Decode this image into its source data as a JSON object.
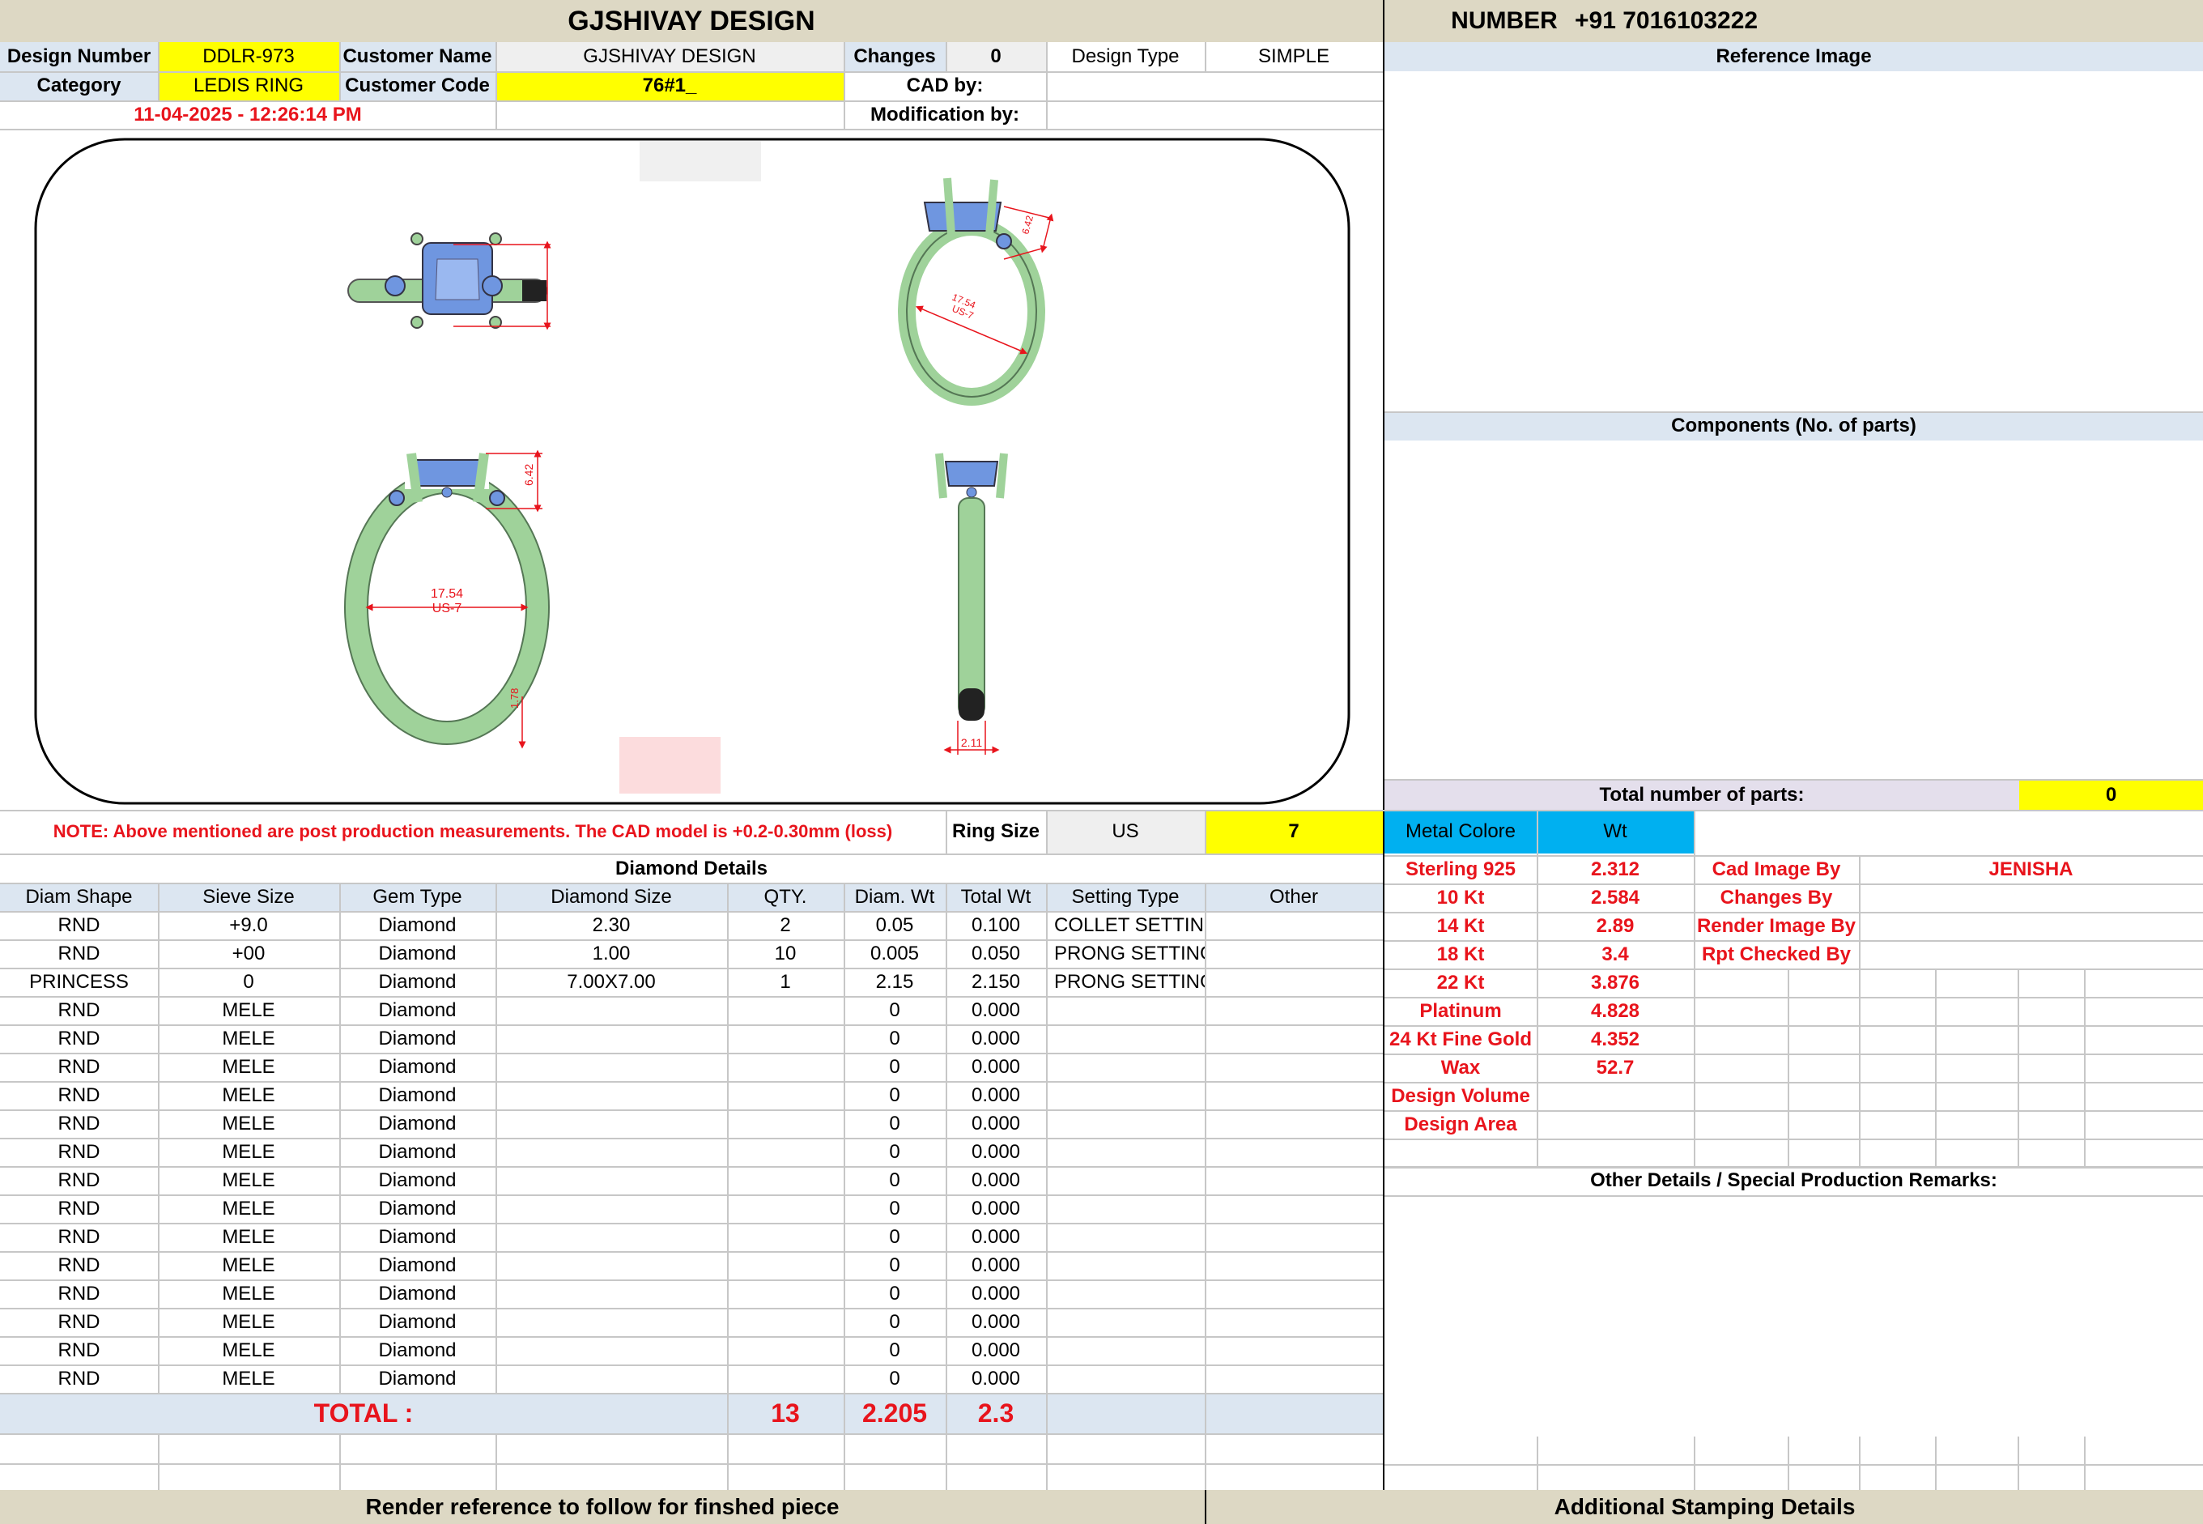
{
  "header": {
    "company": "GJSHIVAY DESIGN",
    "number_label": "NUMBER",
    "phone": "+91 7016103222"
  },
  "info": {
    "design_number_label": "Design Number",
    "design_number": "DDLR-973",
    "customer_name_label": "Customer Name",
    "customer_name": "GJSHIVAY DESIGN",
    "changes_label": "Changes",
    "changes": "0",
    "design_type_label": "Design Type",
    "design_type": "SIMPLE",
    "category_label": "Category",
    "category": "LEDIS RING",
    "customer_code_label": "Customer Code",
    "customer_code": "76#1_",
    "cad_by_label": "CAD by:",
    "modification_by_label": "Modification by:",
    "datetime": "11-04-2025 - 12:26:14 PM"
  },
  "drawings": {
    "top_width": "17.54",
    "top_size": "US-7",
    "top_height": "6.42",
    "front_width": "17.54",
    "front_size": "US-7",
    "front_height": "6.42",
    "front_band": "1.78",
    "side_band": "2.11"
  },
  "right": {
    "reference_image": "Reference Image",
    "components": "Components (No. of parts)",
    "total_parts_label": "Total number of parts:",
    "total_parts": "0",
    "other_details": "Other Details / Special Production Remarks:"
  },
  "note": "NOTE: Above mentioned are post production measurements. The CAD model is +0.2-0.30mm (loss)",
  "ring": {
    "label": "Ring Size",
    "unit": "US",
    "value": "7"
  },
  "metal": {
    "header_label": "Metal Colore",
    "header_wt": "Wt",
    "rows": [
      {
        "name": "Sterling 925",
        "wt": "2.312"
      },
      {
        "name": "10 Kt",
        "wt": "2.584"
      },
      {
        "name": "14 Kt",
        "wt": "2.89"
      },
      {
        "name": "18 Kt",
        "wt": "3.4"
      },
      {
        "name": "22 Kt",
        "wt": "3.876"
      },
      {
        "name": "Platinum",
        "wt": "4.828"
      },
      {
        "name": "24 Kt Fine Gold",
        "wt": "4.352"
      },
      {
        "name": "Wax",
        "wt": "52.7"
      },
      {
        "name": "Design Volume",
        "wt": ""
      },
      {
        "name": "Design Area",
        "wt": ""
      }
    ]
  },
  "staff": {
    "rows": [
      {
        "label": "Cad Image By",
        "value": "JENISHA"
      },
      {
        "label": "Changes By",
        "value": ""
      },
      {
        "label": "Render Image By",
        "value": ""
      },
      {
        "label": "Rpt Checked By",
        "value": ""
      }
    ]
  },
  "diamond": {
    "title": "Diamond Details",
    "columns": [
      "Diam Shape",
      "Sieve Size",
      "Gem Type",
      "Diamond Size",
      "QTY.",
      "Diam. Wt",
      "Total Wt",
      "Setting Type",
      "Other"
    ],
    "rows": [
      [
        "RND",
        "+9.0",
        "Diamond",
        "2.30",
        "2",
        "0.05",
        "0.100",
        "COLLET SETTING",
        ""
      ],
      [
        "RND",
        "+00",
        "Diamond",
        "1.00",
        "10",
        "0.005",
        "0.050",
        "PRONG SETTING",
        ""
      ],
      [
        "PRINCESS",
        "0",
        "Diamond",
        "7.00X7.00",
        "1",
        "2.15",
        "2.150",
        "PRONG SETTING",
        ""
      ],
      [
        "RND",
        "MELE",
        "Diamond",
        "",
        "",
        "0",
        "0.000",
        "",
        ""
      ],
      [
        "RND",
        "MELE",
        "Diamond",
        "",
        "",
        "0",
        "0.000",
        "",
        ""
      ],
      [
        "RND",
        "MELE",
        "Diamond",
        "",
        "",
        "0",
        "0.000",
        "",
        ""
      ],
      [
        "RND",
        "MELE",
        "Diamond",
        "",
        "",
        "0",
        "0.000",
        "",
        ""
      ],
      [
        "RND",
        "MELE",
        "Diamond",
        "",
        "",
        "0",
        "0.000",
        "",
        ""
      ],
      [
        "RND",
        "MELE",
        "Diamond",
        "",
        "",
        "0",
        "0.000",
        "",
        ""
      ],
      [
        "RND",
        "MELE",
        "Diamond",
        "",
        "",
        "0",
        "0.000",
        "",
        ""
      ],
      [
        "RND",
        "MELE",
        "Diamond",
        "",
        "",
        "0",
        "0.000",
        "",
        ""
      ],
      [
        "RND",
        "MELE",
        "Diamond",
        "",
        "",
        "0",
        "0.000",
        "",
        ""
      ],
      [
        "RND",
        "MELE",
        "Diamond",
        "",
        "",
        "0",
        "0.000",
        "",
        ""
      ],
      [
        "RND",
        "MELE",
        "Diamond",
        "",
        "",
        "0",
        "0.000",
        "",
        ""
      ],
      [
        "RND",
        "MELE",
        "Diamond",
        "",
        "",
        "0",
        "0.000",
        "",
        ""
      ],
      [
        "RND",
        "MELE",
        "Diamond",
        "",
        "",
        "0",
        "0.000",
        "",
        ""
      ],
      [
        "RND",
        "MELE",
        "Diamond",
        "",
        "",
        "0",
        "0.000",
        "",
        ""
      ]
    ],
    "total_label": "TOTAL :",
    "total_qty": "13",
    "total_diam_wt": "2.205",
    "total_wt": "2.3"
  },
  "footer": {
    "render_ref": "Render reference to follow for finshed piece",
    "stamping": "Additional Stamping Details"
  }
}
